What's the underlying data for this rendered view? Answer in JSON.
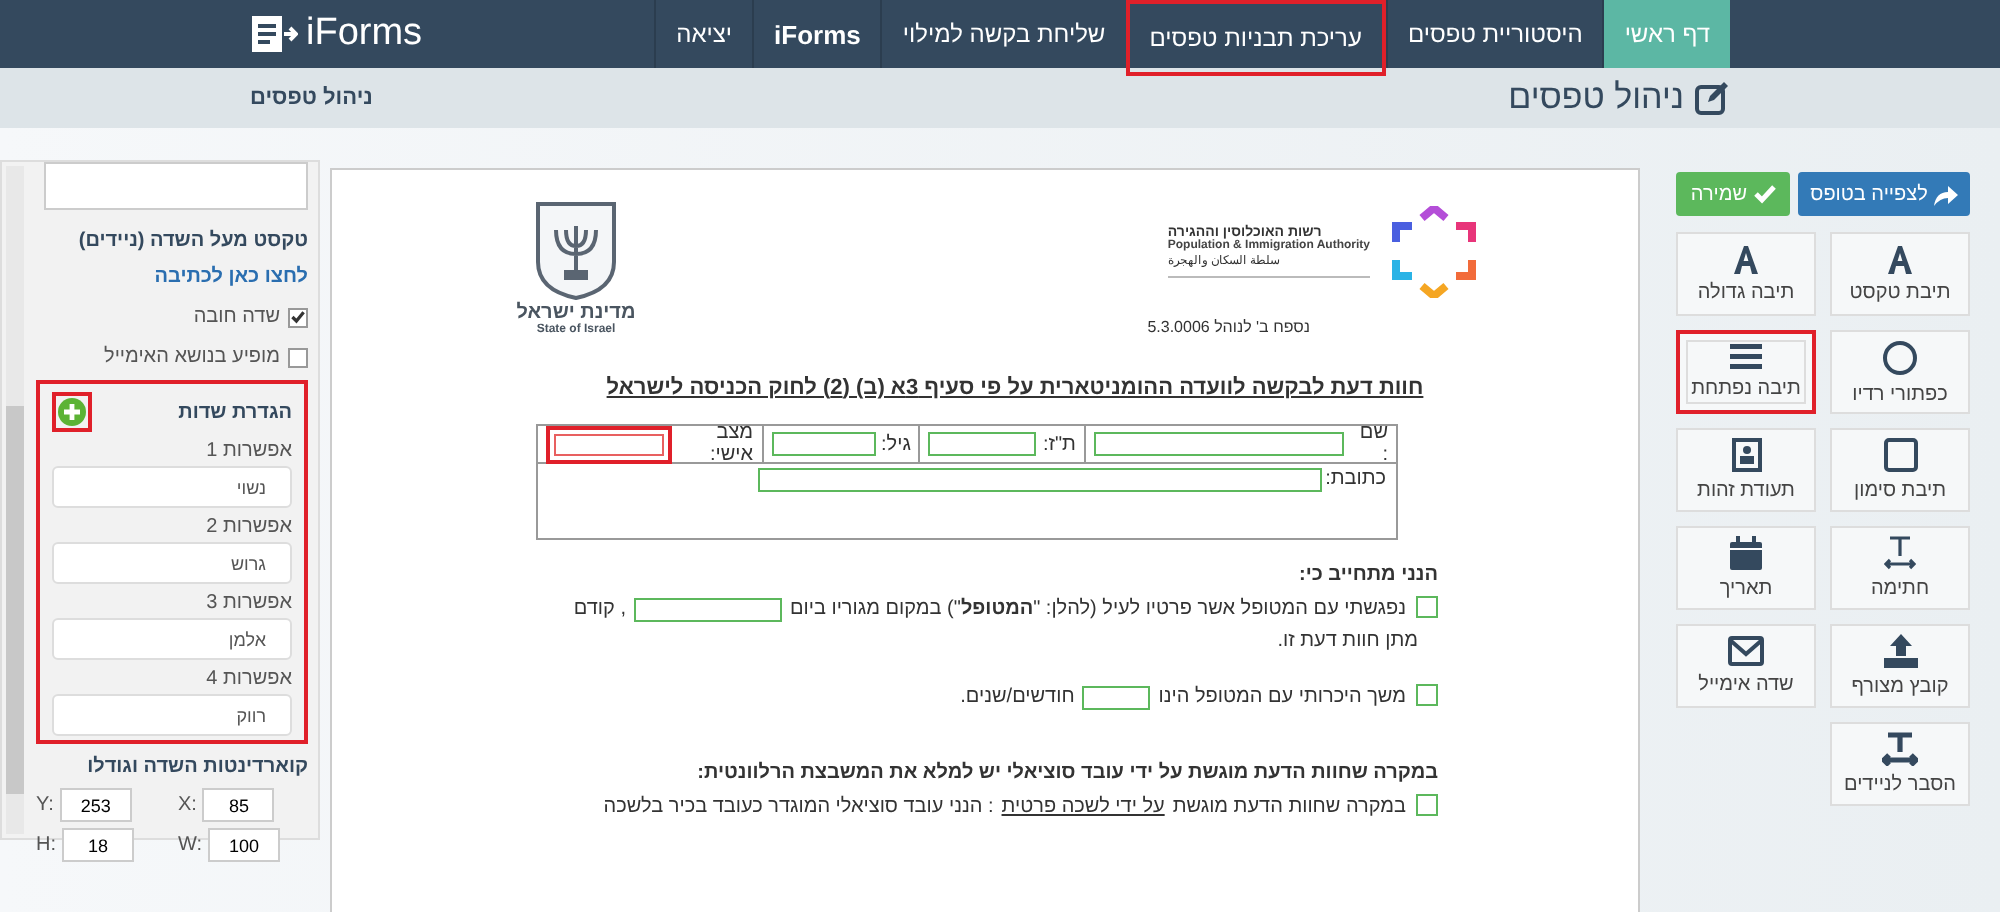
{
  "header": {
    "logo": "iForms",
    "nav": [
      {
        "label": "דף ראשי",
        "selected": true,
        "highlighted": false
      },
      {
        "label": "היסטוריית טפסים",
        "selected": false,
        "highlighted": false
      },
      {
        "label": "עריכת תבניות טפסים",
        "selected": false,
        "highlighted": true
      },
      {
        "label": "שליחת בקשה למילוי",
        "selected": false,
        "highlighted": false
      },
      {
        "label": "iForms",
        "selected": false,
        "highlighted": false
      },
      {
        "label": "יציאה",
        "selected": false,
        "highlighted": false
      }
    ]
  },
  "subheader": {
    "title": "ניהול טפסים",
    "breadcrumb": "ניהול טפסים"
  },
  "properties": {
    "mobile_label": "טקסט מעל השדה (ניידים)",
    "write_link": "לחצו כאן לכתיבה",
    "checkboxes": [
      {
        "label": "שדה חובה",
        "checked": true
      },
      {
        "label": "מופיע בנושא האימייל",
        "checked": false
      }
    ],
    "options_section": {
      "title": "הגדרת שדות",
      "highlighted": true,
      "options": [
        {
          "label": "אפשרות 1",
          "value": "נשוי"
        },
        {
          "label": "אפשרות 2",
          "value": "גרוש"
        },
        {
          "label": "אפשרות 3",
          "value": "אלמן"
        },
        {
          "label": "אפשרות 4",
          "value": "רווק"
        }
      ]
    },
    "coords_title": "קוארדינטות השדה וגודלו",
    "coords": [
      {
        "label": "X:",
        "value": "85"
      },
      {
        "label": "Y:",
        "value": "253"
      },
      {
        "label": "W:",
        "value": "100"
      },
      {
        "label": "H:",
        "value": "18"
      }
    ]
  },
  "document": {
    "emblem": {
      "hebrew": "מדינת ישראל",
      "english": "State of Israel"
    },
    "authority": {
      "hebrew": "רשות האוכלוסין וההגירה",
      "english": "Population & Immigration Authority",
      "arabic": "سلطة السكان والهجرة"
    },
    "appendix": "נספח ב' לנוהל 5.3.0006",
    "title": "חוות דעת לבקשה לוועדה ההומניטארית על פי סעיף 3א (ב) (2) לחוק הכניסה לישראל",
    "table": {
      "row1": [
        {
          "label": "שם :",
          "highlighted": false
        },
        {
          "label": "ת\"ז:",
          "highlighted": false
        },
        {
          "label": "גיל:",
          "highlighted": false
        },
        {
          "label": "מצב אישי:",
          "highlighted": true
        }
      ],
      "address": "כתובת:"
    },
    "commitment_heading": "הנני מתחייב כי:",
    "statements": [
      {
        "before": "נפגשתי עם המטופל אשר פרטיו לעיל (להלן: \"**המטופל**\") במקום מגוריו ביום",
        "after": ", קודם",
        "continuation": "מתן חוות דעת זו.",
        "checked": false
      },
      {
        "before": "משך היכרותי עם המטופל הינו",
        "after": "חודשים/שנים.",
        "checked": false
      }
    ],
    "social_heading": "במקרה שחוות הדעת מוגשת על ידי עובד סוציאלי יש  למלא את המשבצת הרלוונטית:",
    "private_clause": {
      "checked": false,
      "parts": [
        {
          "text": "במקרה שחוות הדעת מוגשת ",
          "underline": false
        },
        {
          "text": "על ידי לשכה פרטית",
          "underline": true
        },
        {
          "text": ": הנני עובד סוציאלי המוגדר כעובד בכיר בלשכה",
          "underline": false
        }
      ]
    }
  },
  "toolbar": {
    "preview": "לצפייה בטופס",
    "save": "שמירה",
    "tools": [
      {
        "label": "תיבת טקסט",
        "kind": "text",
        "highlighted": false
      },
      {
        "label": "תיבה גדולה",
        "kind": "text",
        "highlighted": false
      },
      {
        "label": "כפתורי רדיו",
        "kind": "radio",
        "highlighted": false
      },
      {
        "label": "תיבה נפתחת",
        "kind": "list",
        "highlighted": true
      },
      {
        "label": "תיבת סימון",
        "kind": "checkbox",
        "highlighted": false
      },
      {
        "label": "תעודת זהות",
        "kind": "idcard",
        "highlighted": false
      },
      {
        "label": "חתימה",
        "kind": "signature",
        "highlighted": false
      },
      {
        "label": "תאריך",
        "kind": "calendar",
        "highlighted": false
      },
      {
        "label": "קובץ מצורף",
        "kind": "upload",
        "highlighted": false
      },
      {
        "label": "שדה אימייל",
        "kind": "email",
        "highlighted": false
      },
      {
        "label": "הסבר לניידים",
        "kind": "mobilehelp",
        "highlighted": false
      }
    ]
  }
}
